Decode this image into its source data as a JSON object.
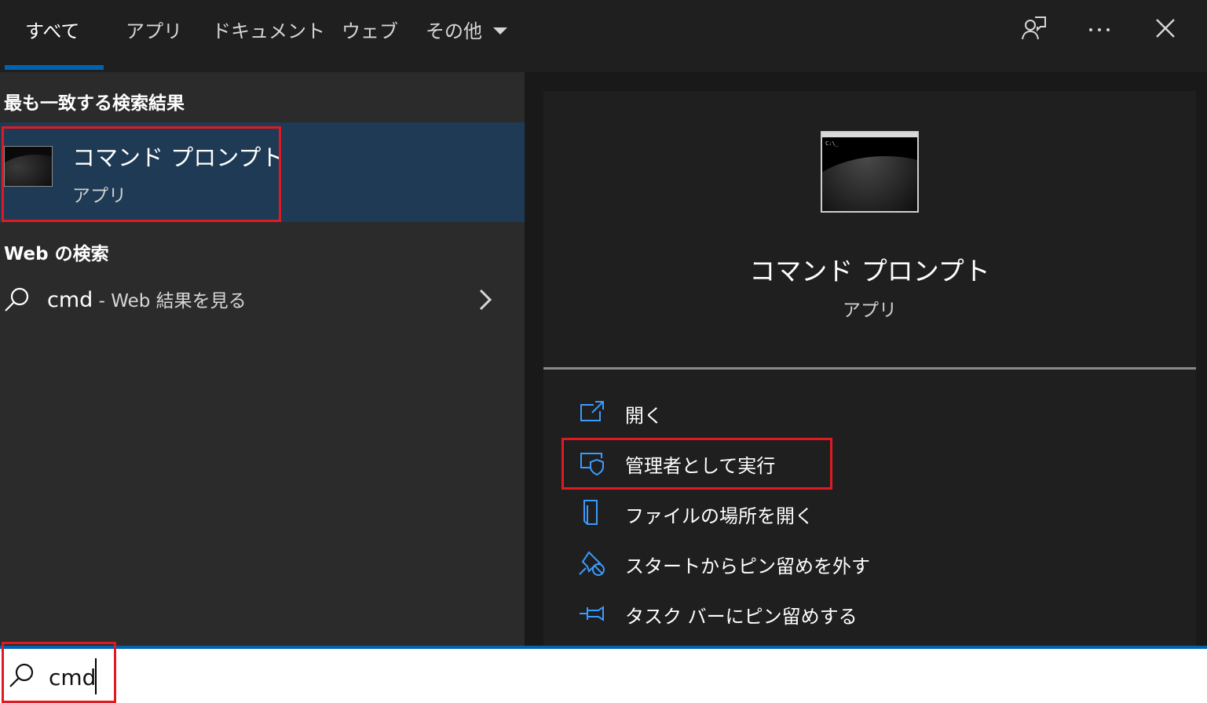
{
  "tabs": [
    {
      "label": "すべて",
      "active": true
    },
    {
      "label": "アプリ"
    },
    {
      "label": "ドキュメント"
    },
    {
      "label": "ウェブ"
    },
    {
      "label": "その他"
    }
  ],
  "top_icons": [
    "feedback-icon",
    "more-icon",
    "close-icon"
  ],
  "left": {
    "best_match_title": "最も一致する検索結果",
    "best_match": {
      "name": "コマンド プロンプト",
      "type": "アプリ"
    },
    "web_title": "Web の検索",
    "web_result": {
      "query": "cmd",
      "suffix": " - Web 結果を見る"
    }
  },
  "detail": {
    "name": "コマンド プロンプト",
    "type": "アプリ",
    "thumb_prompt": "C:\\_",
    "actions": [
      {
        "label": "開く",
        "icon": "open-icon"
      },
      {
        "label": "管理者として実行",
        "icon": "admin-shield-icon"
      },
      {
        "label": "ファイルの場所を開く",
        "icon": "file-location-icon"
      },
      {
        "label": "スタートからピン留めを外す",
        "icon": "unpin-icon"
      },
      {
        "label": "タスク バーにピン留めする",
        "icon": "pin-taskbar-icon"
      }
    ]
  },
  "search": {
    "value": "cmd"
  },
  "colors": {
    "accent": "#0063b1",
    "highlight": "#e01a22",
    "selected": "#1e3a54"
  }
}
